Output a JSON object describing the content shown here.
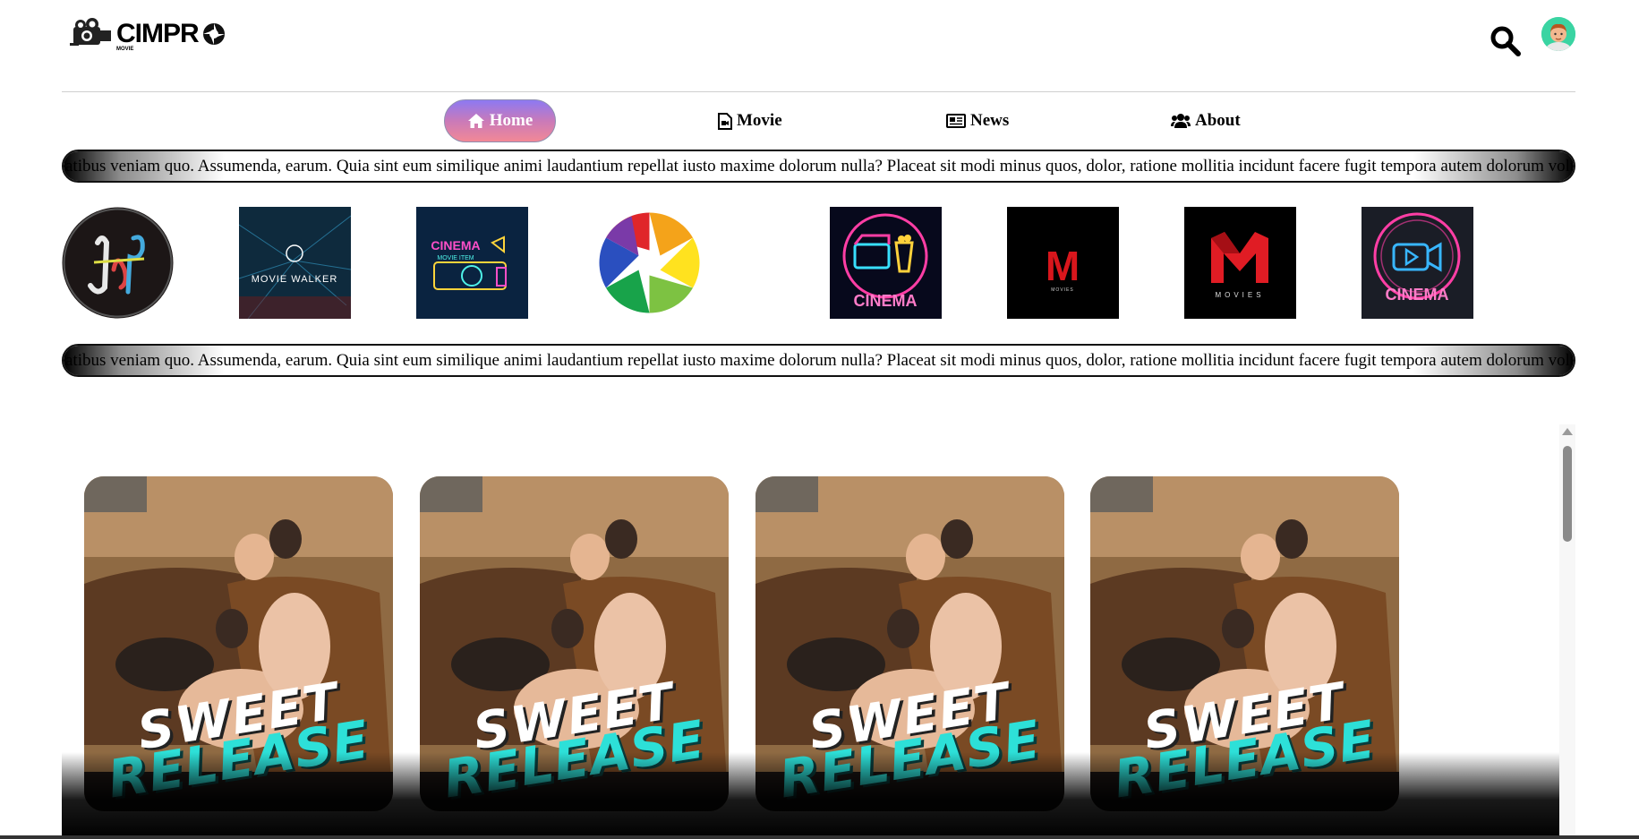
{
  "header": {
    "logo_text": "CIMPR",
    "logo_sub": "MOVIE",
    "search_icon": "search-icon",
    "avatar_icon": "user-avatar"
  },
  "nav": [
    {
      "label": "Home",
      "icon": "home-icon",
      "active": true
    },
    {
      "label": "Movie",
      "icon": "video-file-icon",
      "active": false
    },
    {
      "label": "News",
      "icon": "newspaper-icon",
      "active": false
    },
    {
      "label": "About",
      "icon": "users-icon",
      "active": false
    }
  ],
  "marquee": {
    "text": "atibus veniam quo. Assumenda, earum. Quia sint eum similique animi laudantium repellat iusto maxime dolorum nulla? Placeat sit modi minus quos, dolor, ratione mollitia incidunt facere fugit tempora autem dolorum volu"
  },
  "logos": [
    {
      "name": "jay-logo"
    },
    {
      "name": "movie-walker-logo",
      "text": "MOVIE WALKER"
    },
    {
      "name": "cinema-movie-item-logo",
      "text": "CINEMA",
      "sub": "MOVIE ITEM"
    },
    {
      "name": "aperture-logo"
    },
    {
      "name": "cinema-neon-popcorn-logo",
      "text": "CINEMA"
    },
    {
      "name": "m-movies-small-logo",
      "text": "M",
      "sub": "MOVIES"
    },
    {
      "name": "m-movies-large-logo",
      "text": "M",
      "sub": "MOVIES"
    },
    {
      "name": "cinema-neon-camera-logo",
      "text": "CINEMA"
    }
  ],
  "cards": [
    {
      "line1": "SWEET",
      "line2": "RELEASE"
    },
    {
      "line1": "SWEET",
      "line2": "RELEASE"
    },
    {
      "line1": "SWEET",
      "line2": "RELEASE"
    },
    {
      "line1": "SWEET",
      "line2": "RELEASE"
    }
  ],
  "colors": {
    "accent_gradient_start": "#8d79f2",
    "accent_gradient_end": "#f28896",
    "poster_cyan": "#2de0d8",
    "avatar_bg": "#3ad4a2"
  }
}
